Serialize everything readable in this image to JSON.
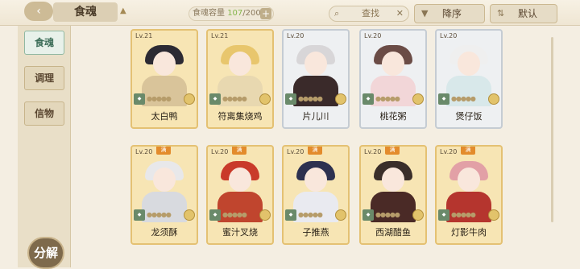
{
  "header": {
    "back_icon": "back-arrow-icon",
    "title": "食魂",
    "capacity_label": "食魂容量",
    "capacity_current": "107",
    "capacity_max": "/200",
    "search_placeholder": "查找",
    "sort_desc_label": "降序",
    "sort_default_label": "默认"
  },
  "sidebar": {
    "tabs": [
      {
        "label": "食魂",
        "active": true
      },
      {
        "label": "调理",
        "active": false
      },
      {
        "label": "信物",
        "active": false
      }
    ],
    "decompose_label": "分解"
  },
  "cards": [
    {
      "level": "Lv.21",
      "name": "太白鸭",
      "rarity": "gold",
      "full": false,
      "hair": "#2c2a33",
      "body": "#d9c49a"
    },
    {
      "level": "Lv.21",
      "name": "符离集烧鸡",
      "rarity": "gold",
      "full": false,
      "hair": "#e8c66d",
      "body": "#e8d8b0"
    },
    {
      "level": "Lv.20",
      "name": "片儿川",
      "rarity": "silver",
      "full": false,
      "hair": "#d8d6d8",
      "body": "#3a2a2a"
    },
    {
      "level": "Lv.20",
      "name": "桃花粥",
      "rarity": "silver",
      "full": false,
      "hair": "#6b4c46",
      "body": "#f2d6d8"
    },
    {
      "level": "Lv.20",
      "name": "煲仔饭",
      "rarity": "silver",
      "full": false,
      "hair": "#efefef",
      "body": "#d8e8ea"
    },
    {
      "level": "Lv.20",
      "name": "龙须酥",
      "rarity": "gold",
      "full": true,
      "hair": "#e8e8ea",
      "body": "#d8dadf"
    },
    {
      "level": "Lv.20",
      "name": "蜜汁叉烧",
      "rarity": "gold",
      "full": true,
      "hair": "#c93a2a",
      "body": "#c0452e"
    },
    {
      "level": "Lv.20",
      "name": "子推燕",
      "rarity": "gold",
      "full": true,
      "hair": "#2d3150",
      "body": "#e9eaf0"
    },
    {
      "level": "Lv.20",
      "name": "西湖醋鱼",
      "rarity": "gold",
      "full": true,
      "hair": "#3a2e2a",
      "body": "#4a2a26"
    },
    {
      "level": "Lv.20",
      "name": "灯影牛肉",
      "rarity": "gold",
      "full": true,
      "hair": "#e2a0a6",
      "body": "#b5352e"
    }
  ],
  "full_badge": "满"
}
